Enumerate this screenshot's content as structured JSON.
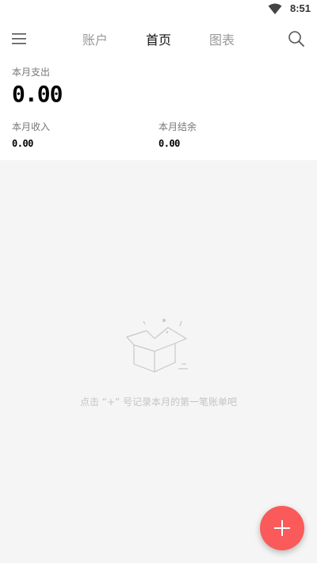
{
  "status_bar": {
    "time": "8:51",
    "icons": [
      "wifi-icon"
    ]
  },
  "header": {
    "menu_icon": "hamburger-menu-icon",
    "tabs": [
      {
        "label": "账户",
        "active": false
      },
      {
        "label": "首页",
        "active": true
      },
      {
        "label": "图表",
        "active": false
      }
    ],
    "search_icon": "search-icon"
  },
  "summary": {
    "expense_label": "本月支出",
    "expense_value": "0.00",
    "income_label": "本月收入",
    "income_value": "0.00",
    "balance_label": "本月结余",
    "balance_value": "0.00"
  },
  "empty_state": {
    "icon": "empty-box-icon",
    "hint": "点击 “+” 号记录本月的第一笔账单吧"
  },
  "fab": {
    "icon": "plus-icon"
  },
  "colors": {
    "accent": "#fa5a5a",
    "background": "#f5f5f5",
    "surface": "#ffffff"
  }
}
